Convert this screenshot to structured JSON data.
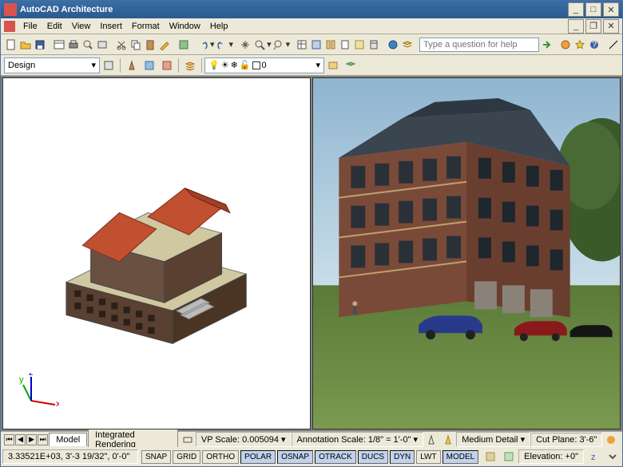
{
  "titlebar": {
    "title": "AutoCAD Architecture"
  },
  "menubar": {
    "items": [
      "File",
      "Edit",
      "View",
      "Insert",
      "Format",
      "Window",
      "Help"
    ]
  },
  "help_placeholder": "Type a question for help",
  "toolbar2": {
    "design_label": "Design",
    "layer_value": "0"
  },
  "tabs": {
    "model": "Model",
    "rendering": "Integrated Rendering"
  },
  "statusbar1": {
    "vp_scale_label": "VP Scale:",
    "vp_scale_value": "0.005094",
    "annotation_scale_label": "Annotation Scale:",
    "annotation_scale_value": "1/8\" = 1'-0\"",
    "detail": "Medium Detail",
    "cut_plane_label": "Cut Plane:",
    "cut_plane_value": "3'-6\""
  },
  "statusbar2": {
    "coords": "3.33521E+03, 3'-3 19/32\", 0'-0\"",
    "toggles": [
      "SNAP",
      "GRID",
      "ORTHO",
      "POLAR",
      "OSNAP",
      "OTRACK",
      "DUCS",
      "DYN",
      "LWT",
      "MODEL"
    ],
    "elevation_label": "Elevation:",
    "elevation_value": "+0\""
  }
}
